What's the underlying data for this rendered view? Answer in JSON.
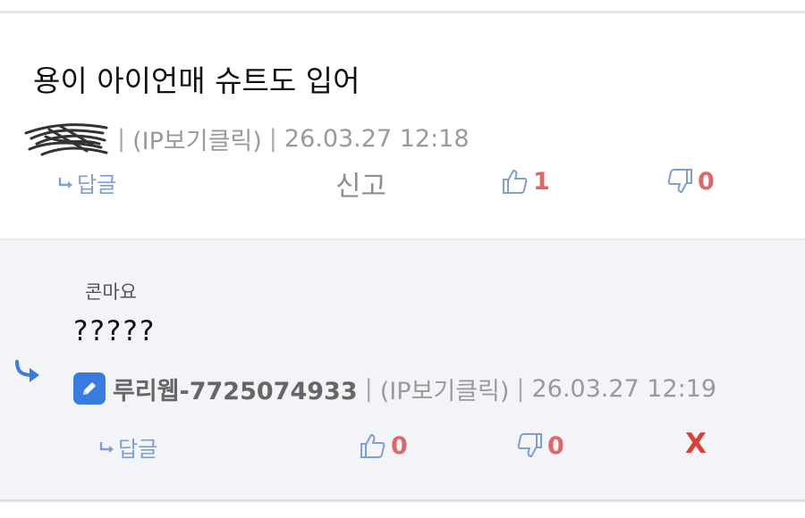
{
  "comment": {
    "text": "용이 아이언매 슈트도 입어",
    "ip_label": "(IP보기클릭)",
    "timestamp": "26.03.27 12:18",
    "separator": "|",
    "reply_label": "답글",
    "report_label": "신고",
    "likes": "1",
    "dislikes": "0"
  },
  "reply": {
    "parent_author": "콘마요",
    "text": "?????",
    "author": "루리웹-7725074933",
    "ip_label": "(IP보기클릭)",
    "timestamp": "26.03.27 12:19",
    "separator": "|",
    "reply_label": "답글",
    "likes": "0",
    "dislikes": "0",
    "delete_label": "X"
  },
  "colors": {
    "accent_blue": "#7e9fd3",
    "count_red": "#e06767",
    "delete_red": "#d9403a",
    "badge_blue": "#3a7be0",
    "reply_background": "#f3f4f8"
  },
  "icons": [
    "redacted-scribble",
    "reply-arrow-icon",
    "thumbs-up-icon",
    "thumbs-down-icon",
    "reply-indent-icon",
    "pencil-icon"
  ]
}
